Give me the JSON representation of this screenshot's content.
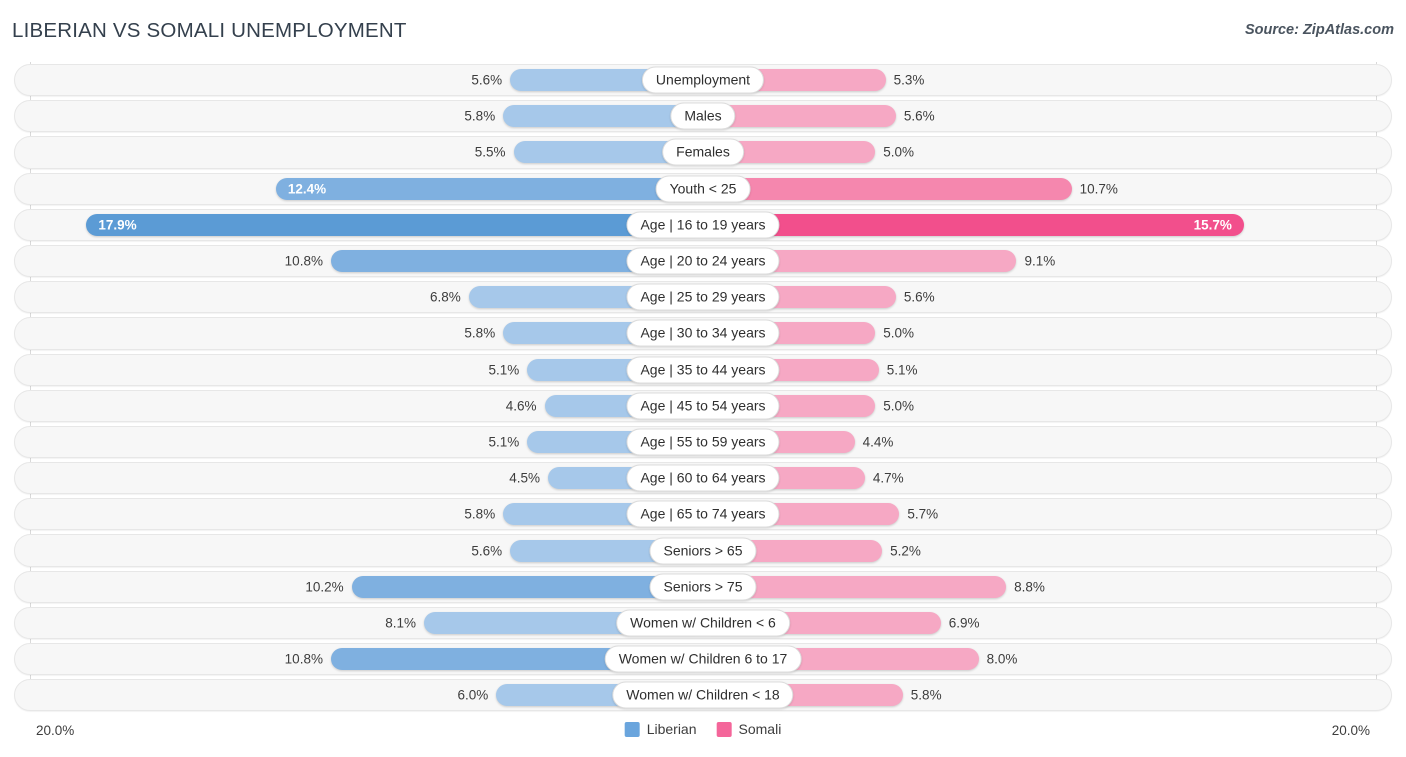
{
  "header": {
    "title": "LIBERIAN VS SOMALI UNEMPLOYMENT",
    "source": "Source: ZipAtlas.com"
  },
  "legend": {
    "items": [
      {
        "label": "Liberian",
        "color": "#6aa5dd"
      },
      {
        "label": "Somali",
        "color": "#f4669a"
      }
    ]
  },
  "axis": {
    "left_tick": "20.0%",
    "right_tick": "20.0%",
    "max": 20.0
  },
  "colors": {
    "left_light": "#a6c8ea",
    "left_mid": "#7fb0e0",
    "left_dark": "#5b9bd5",
    "right_light": "#f6a8c4",
    "right_mid": "#f587ae",
    "right_dark": "#f24f8c",
    "track": "#f7f7f7",
    "track_border": "#e7e7e7",
    "text": "#3d3d3d",
    "title": "#34404d"
  },
  "chart_data": {
    "type": "bar",
    "orientation": "horizontal-diverging",
    "title": "LIBERIAN VS SOMALI UNEMPLOYMENT",
    "subtitle": "",
    "xlabel": "",
    "ylabel": "",
    "xlim": [
      0,
      20.0
    ],
    "unit": "%",
    "grid": false,
    "legend_position": "bottom-center",
    "categories": [
      "Unemployment",
      "Males",
      "Females",
      "Youth < 25",
      "Age | 16 to 19 years",
      "Age | 20 to 24 years",
      "Age | 25 to 29 years",
      "Age | 30 to 34 years",
      "Age | 35 to 44 years",
      "Age | 45 to 54 years",
      "Age | 55 to 59 years",
      "Age | 60 to 64 years",
      "Age | 65 to 74 years",
      "Seniors > 65",
      "Seniors > 75",
      "Women w/ Children < 6",
      "Women w/ Children 6 to 17",
      "Women w/ Children < 18"
    ],
    "series": [
      {
        "name": "Liberian",
        "side": "left",
        "color": "#6aa5dd",
        "values": [
          5.6,
          5.8,
          5.5,
          12.4,
          17.9,
          10.8,
          6.8,
          5.8,
          5.1,
          4.6,
          5.1,
          4.5,
          5.8,
          5.6,
          10.2,
          8.1,
          10.8,
          6.0
        ],
        "labels": [
          "5.6%",
          "5.8%",
          "5.5%",
          "12.4%",
          "17.9%",
          "10.8%",
          "6.8%",
          "5.8%",
          "5.1%",
          "4.6%",
          "5.1%",
          "4.5%",
          "5.8%",
          "5.6%",
          "10.2%",
          "8.1%",
          "10.8%",
          "6.0%"
        ]
      },
      {
        "name": "Somali",
        "side": "right",
        "color": "#f4669a",
        "values": [
          5.3,
          5.6,
          5.0,
          10.7,
          15.7,
          9.1,
          5.6,
          5.0,
          5.1,
          5.0,
          4.4,
          4.7,
          5.7,
          5.2,
          8.8,
          6.9,
          8.0,
          5.8
        ],
        "labels": [
          "5.3%",
          "5.6%",
          "5.0%",
          "10.7%",
          "15.7%",
          "9.1%",
          "5.6%",
          "5.0%",
          "5.1%",
          "5.0%",
          "4.4%",
          "4.7%",
          "5.7%",
          "5.2%",
          "8.8%",
          "6.9%",
          "8.0%",
          "5.8%"
        ]
      }
    ]
  }
}
